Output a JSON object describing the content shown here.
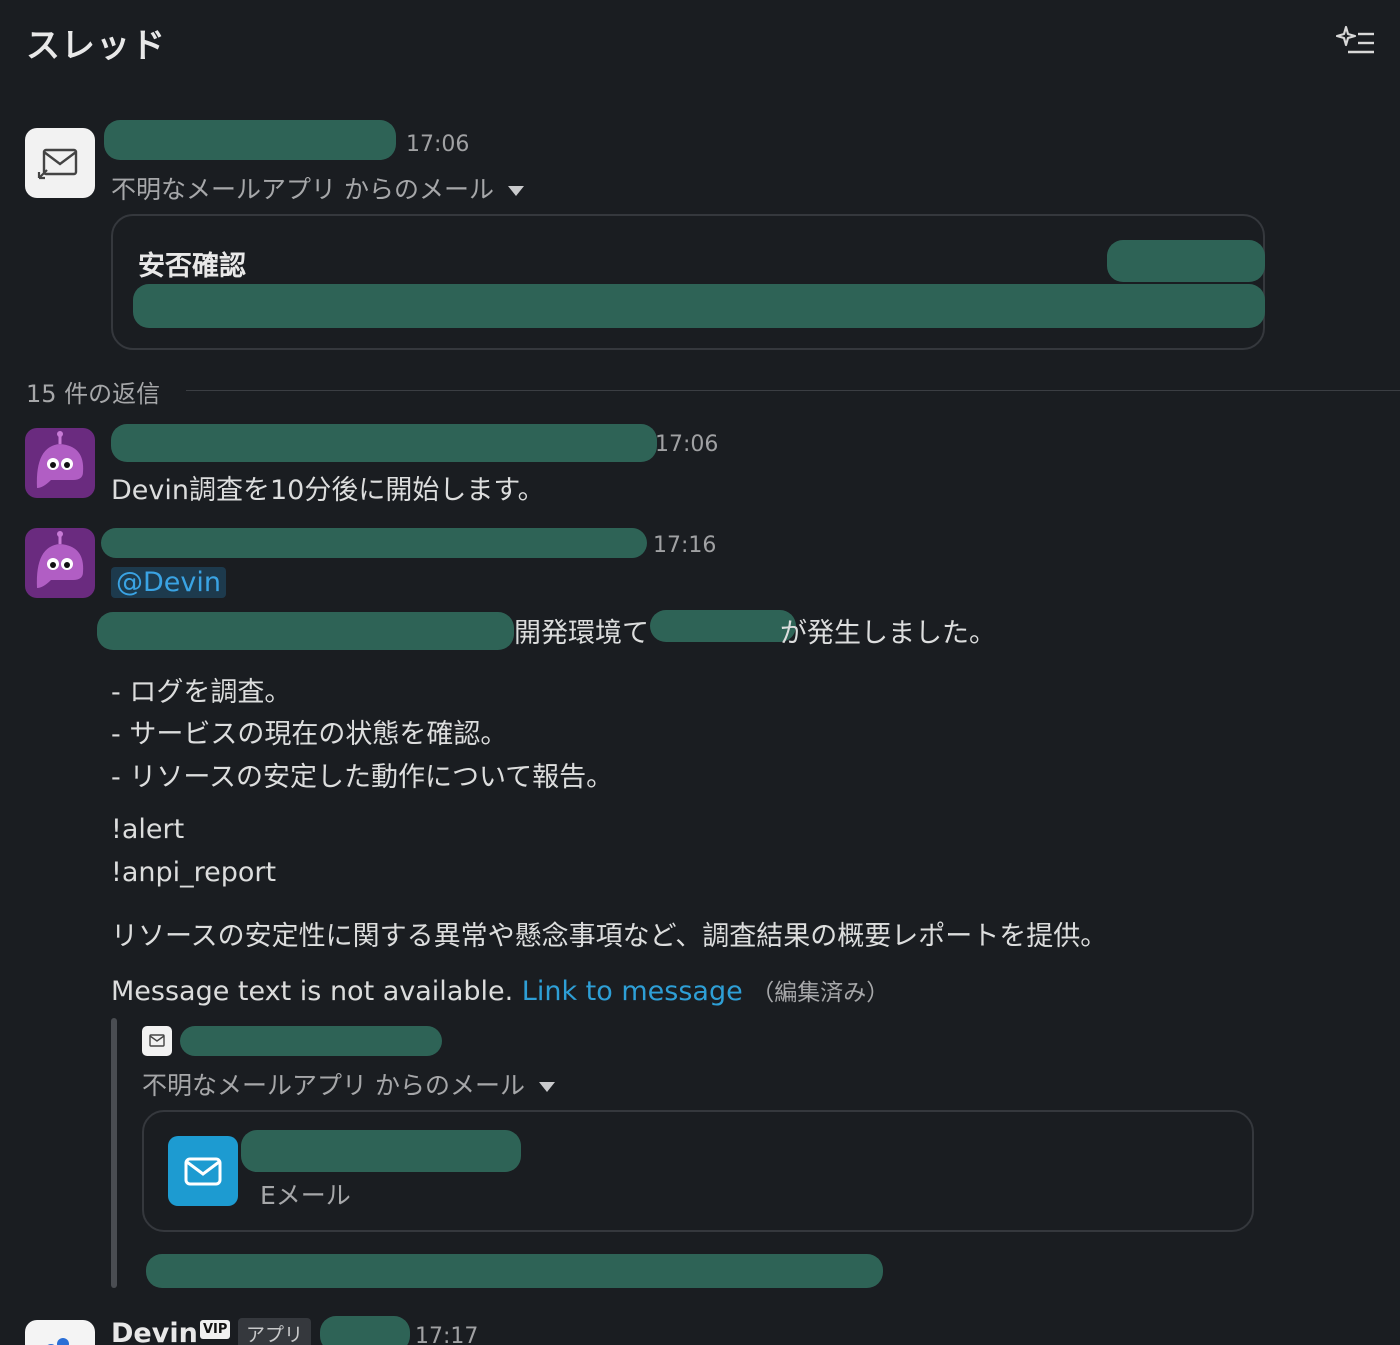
{
  "header": {
    "title": "スレッド",
    "filter_icon": "sparkle-list-icon"
  },
  "root_message": {
    "time": "17:06",
    "source_label": "不明なメールアプリ からのメール",
    "card_title": "安否確認",
    "icon": "mail-forward-icon"
  },
  "replies_divider": {
    "label": "15 件の返信"
  },
  "messages": [
    {
      "time": "17:06",
      "text": "Devin調査を10分後に開始します。"
    },
    {
      "time": "17:16",
      "mention": "@Devin",
      "line1": "開発環境て",
      "line1b": "が発生しました。",
      "bullets": [
        "- ログを調査。",
        "- サービスの現在の状態を確認。",
        "- リソースの安定した動作について報告。"
      ],
      "commands": [
        "!alert",
        "!anpi_report"
      ],
      "summary": "リソースの安定性に関する異常や懸念事項など、調査結果の概要レポートを提供。",
      "unavailable": "Message text is not available.",
      "link": "Link to message",
      "edited": "（編集済み）",
      "quote": {
        "source_label": "不明なメールアプリ からのメール",
        "attachment_type": "Eメール"
      }
    },
    {
      "sender": "Devin",
      "badge_vip": "VIP",
      "badge_app": "アプリ",
      "time": "17:17"
    }
  ],
  "colors": {
    "background": "#1a1d21",
    "redaction": "#2e6356",
    "link": "#2e9fd6",
    "avatar_bot": "#6a2b7f",
    "email_icon_bg": "#1d9bd1"
  }
}
